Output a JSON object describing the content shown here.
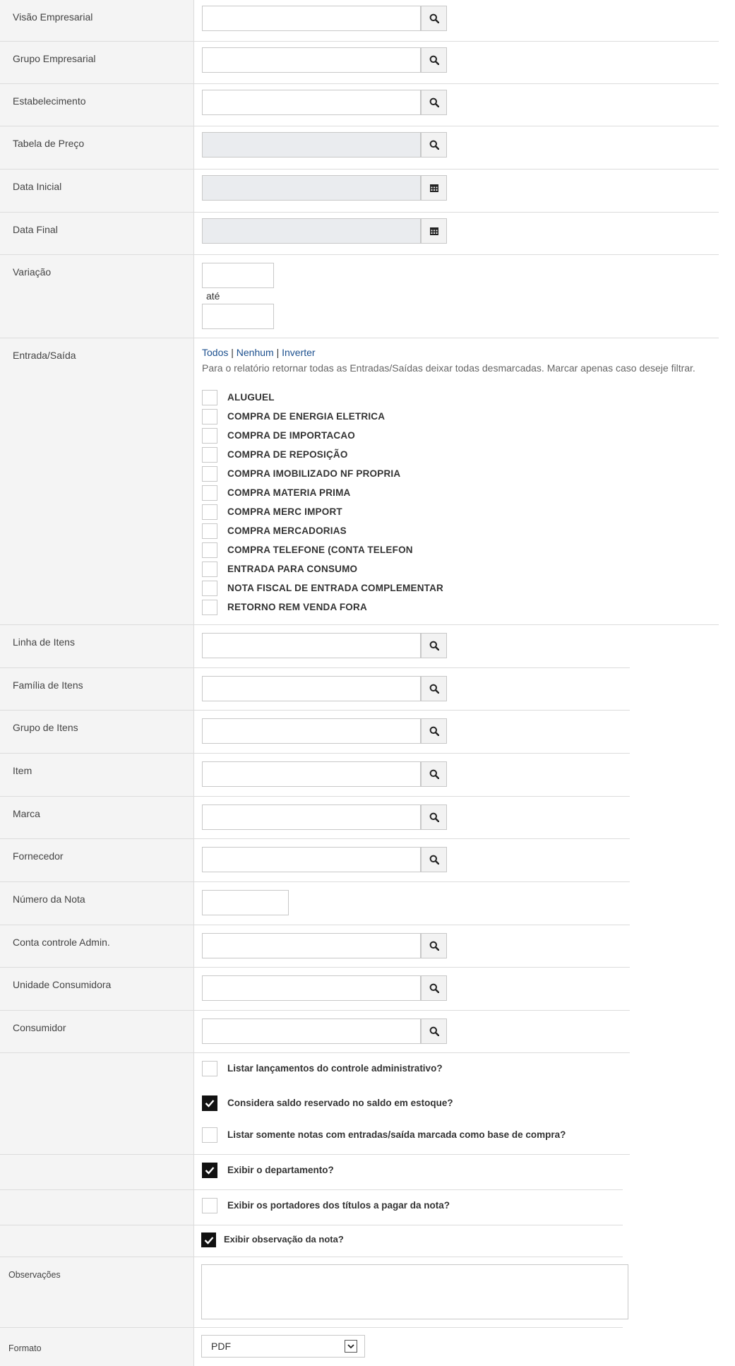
{
  "filters": {
    "visao": {
      "label": "Visão Empresarial",
      "value": ""
    },
    "grupo": {
      "label": "Grupo Empresarial",
      "value": ""
    },
    "estab": {
      "label": "Estabelecimento",
      "value": ""
    },
    "tabela": {
      "label": "Tabela de Preço",
      "value": ""
    },
    "data_inicial": {
      "label": "Data Inicial",
      "value": ""
    },
    "data_final": {
      "label": "Data Final",
      "value": ""
    },
    "variacao": {
      "label": "Variação",
      "ate": "até"
    }
  },
  "entrada_saida": {
    "label": "Entrada/Saída",
    "links": {
      "todos": "Todos",
      "nenhum": "Nenhum",
      "inverter": "Inverter",
      "sep": "|"
    },
    "hint": "Para o relatório retornar todas as Entradas/Saídas deixar todas desmarcadas. Marcar apenas caso deseje filtrar.",
    "items": [
      "ALUGUEL",
      "COMPRA DE ENERGIA ELETRICA",
      "COMPRA DE IMPORTACAO",
      "COMPRA DE REPOSIÇÃO",
      "COMPRA IMOBILIZADO NF PROPRIA",
      "COMPRA MATERIA PRIMA",
      "COMPRA MERC IMPORT",
      "COMPRA MERCADORIAS",
      "COMPRA TELEFONE (CONTA TELEFON",
      "ENTRADA PARA CONSUMO",
      "NOTA FISCAL DE ENTRADA COMPLEMENTAR",
      "RETORNO REM VENDA FORA"
    ]
  },
  "filters2": {
    "linha": {
      "label": "Linha de Itens"
    },
    "familia": {
      "label": "Família de Itens"
    },
    "grupo_itens": {
      "label": "Grupo de Itens"
    },
    "item": {
      "label": "Item"
    },
    "marca": {
      "label": "Marca"
    },
    "fornecedor": {
      "label": "Fornecedor"
    },
    "numero_nota": {
      "label": "Número da Nota"
    },
    "conta": {
      "label": "Conta controle Admin."
    },
    "unidade": {
      "label": "Unidade Consumidora"
    },
    "consumidor": {
      "label": "Consumidor"
    }
  },
  "options": {
    "listar_lanc": {
      "label": "Listar lançamentos do controle administrativo?",
      "checked": false
    },
    "considera_saldo": {
      "label": "Considera saldo reservado no saldo em estoque?",
      "checked": true
    },
    "listar_somente": {
      "label": "Listar somente notas com entradas/saída marcada como base de compra?",
      "checked": false
    },
    "exibir_depto": {
      "label": "Exibir o departamento?",
      "checked": true
    },
    "exibir_portadores": {
      "label": "Exibir os portadores dos títulos a pagar da nota?",
      "checked": false
    },
    "exibir_obs": {
      "label": "Exibir observação da nota?",
      "checked": true
    }
  },
  "observacoes": {
    "label": "Observações",
    "value": ""
  },
  "formato": {
    "label": "Formato",
    "selected": "PDF"
  },
  "icons": {
    "search": "search-icon",
    "calendar": "calendar-icon",
    "check": "check-icon",
    "dropdown": "chevron-down-icon"
  }
}
